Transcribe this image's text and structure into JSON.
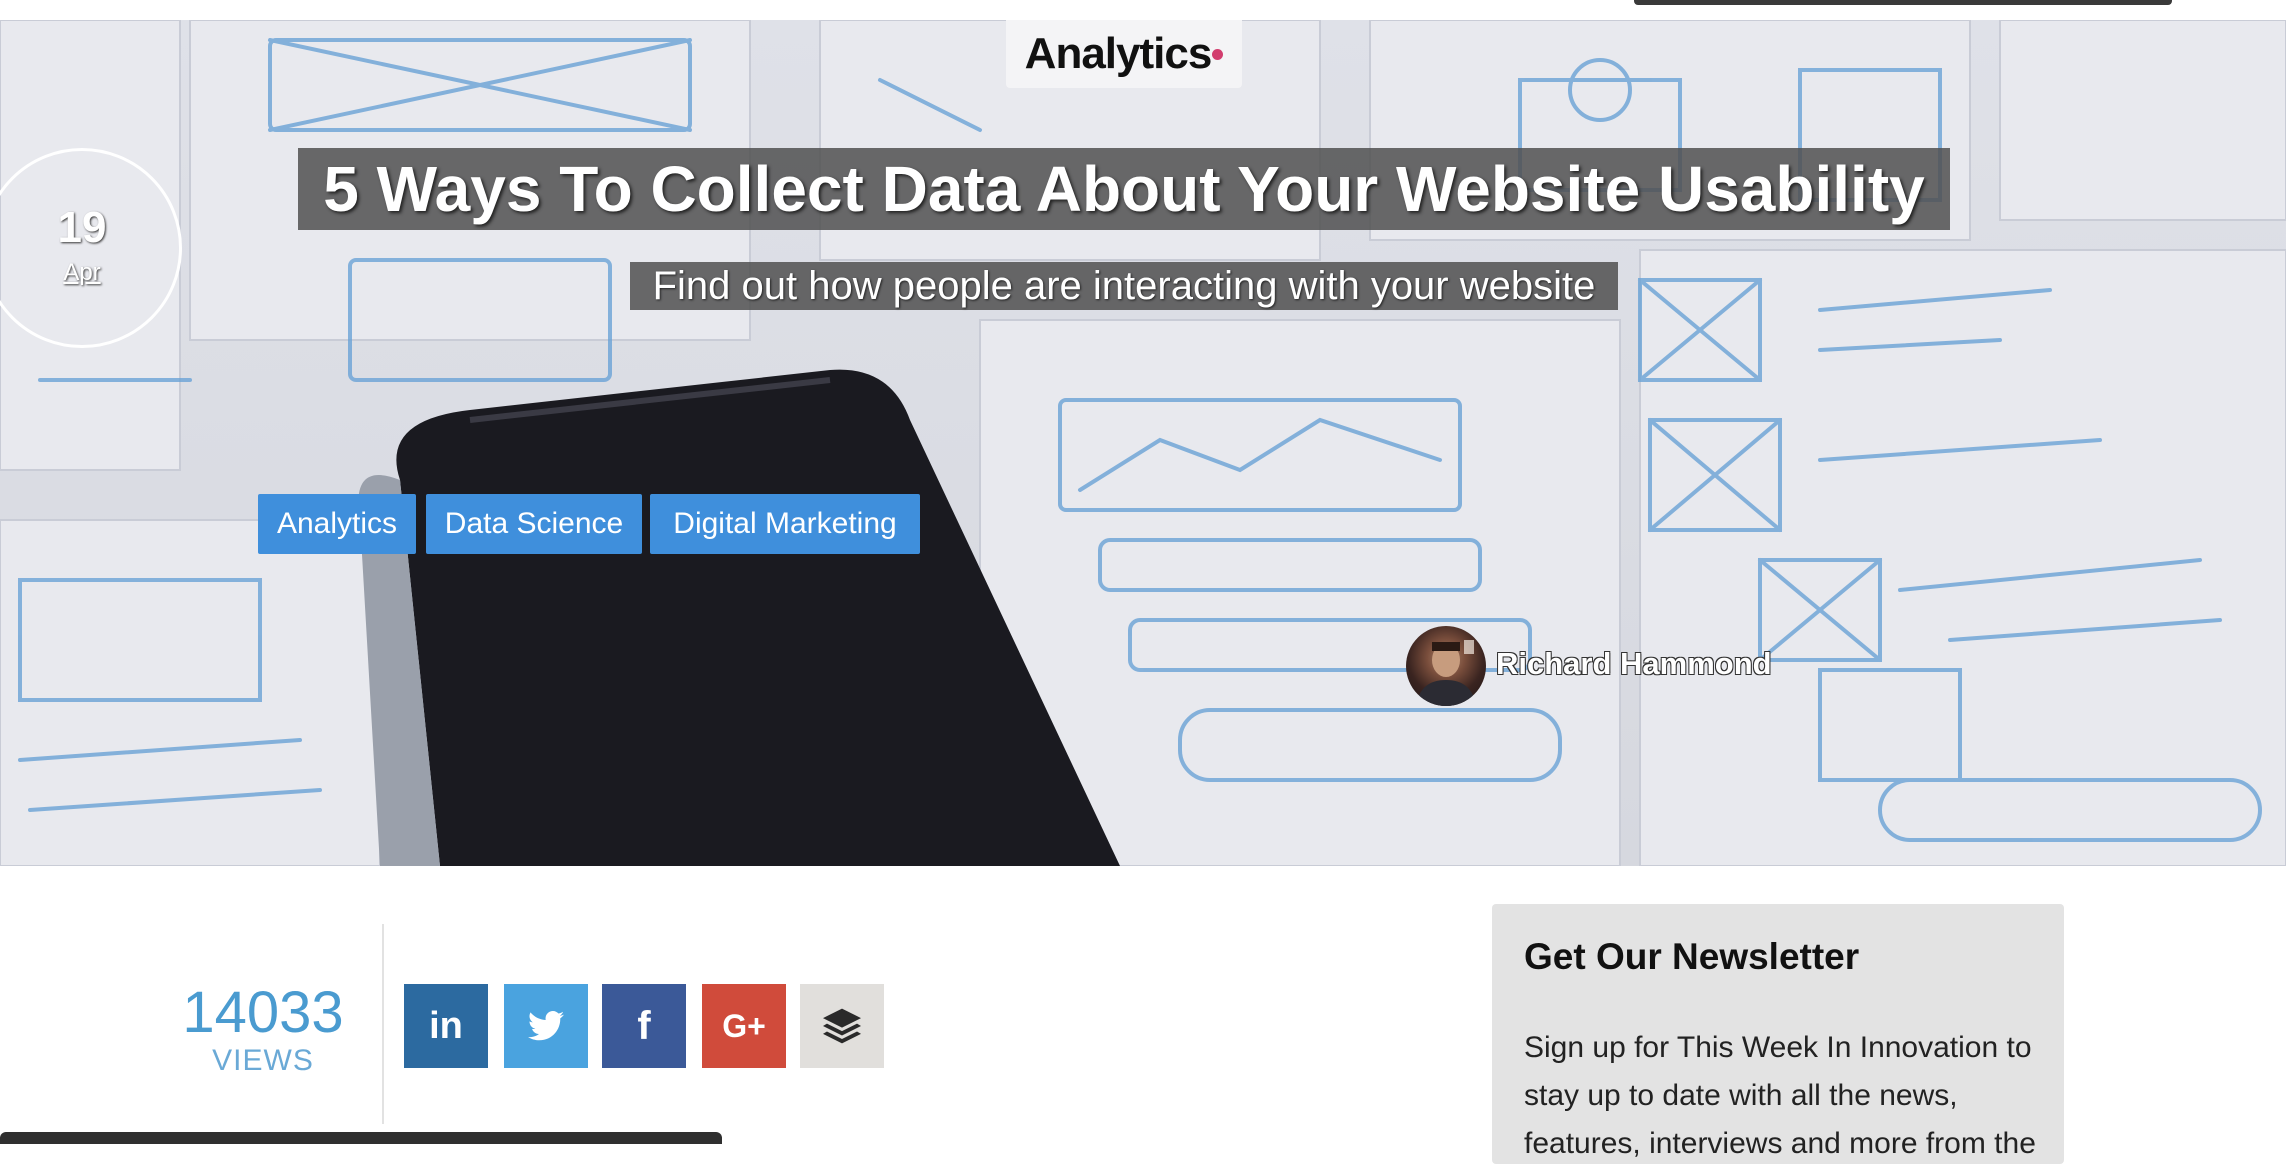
{
  "brand": {
    "logo_text": "Analytics"
  },
  "article": {
    "date_day": "19",
    "date_month": "Apr",
    "title": "5 Ways To Collect Data About Your Website Usability",
    "subtitle": "Find out how people are interacting with your website",
    "tags": [
      "Analytics",
      "Data Science",
      "Digital Marketing"
    ],
    "author": "Richard Hammond"
  },
  "stats": {
    "views": "14033",
    "views_label": "VIEWS"
  },
  "share": {
    "buttons": [
      {
        "name": "linkedin",
        "glyph": "in",
        "color": "#2c6aa0"
      },
      {
        "name": "twitter",
        "glyph": "twitter-bird",
        "color": "#4aa3df"
      },
      {
        "name": "facebook",
        "glyph": "f",
        "color": "#3b5998"
      },
      {
        "name": "google-plus",
        "glyph": "G+",
        "color": "#d04b3b"
      },
      {
        "name": "buffer",
        "glyph": "layers",
        "color": "#e1dfdc"
      }
    ]
  },
  "newsletter": {
    "title": "Get Our Newsletter",
    "text": "Sign up for This Week In Innovation to stay up to date with all the news, features, interviews and more from the"
  }
}
